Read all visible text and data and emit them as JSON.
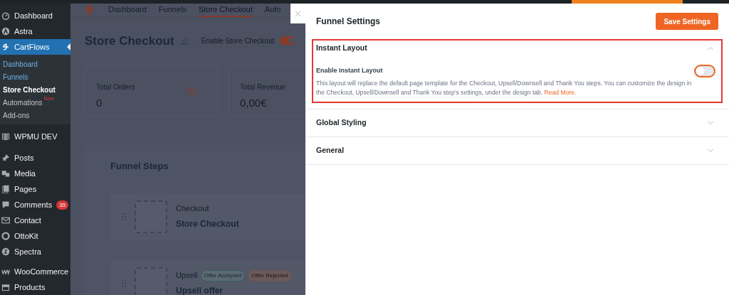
{
  "sidebar": {
    "items": [
      {
        "label": "Dashboard",
        "selected": false
      },
      {
        "label": "Astra",
        "selected": false
      },
      {
        "label": "CartFlows",
        "selected": true,
        "children": [
          {
            "label": "Dashboard",
            "selected": false,
            "link": true
          },
          {
            "label": "Funnels",
            "selected": false,
            "link": true
          },
          {
            "label": "Store Checkout",
            "selected": true,
            "link": false
          },
          {
            "label": "Automations",
            "selected": false,
            "link": false,
            "badge": "New"
          },
          {
            "label": "Add-ons",
            "selected": false,
            "link": false
          }
        ]
      },
      {
        "label": "WPMU DEV",
        "selected": false
      },
      {
        "label": "Posts",
        "selected": false
      },
      {
        "label": "Media",
        "selected": false
      },
      {
        "label": "Pages",
        "selected": false
      },
      {
        "label": "Comments",
        "selected": false,
        "count": "35"
      },
      {
        "label": "Contact",
        "selected": false
      },
      {
        "label": "OttoKit",
        "selected": false
      },
      {
        "label": "Spectra",
        "selected": false
      },
      {
        "label": "WooCommerce",
        "selected": false
      },
      {
        "label": "Products",
        "selected": false
      }
    ]
  },
  "app": {
    "tabs": [
      {
        "label": "Dashboard",
        "selected": false
      },
      {
        "label": "Funnels",
        "selected": false
      },
      {
        "label": "Store Checkout",
        "selected": true
      },
      {
        "label": "Auto",
        "selected": false
      }
    ],
    "title": "Store Checkout",
    "toggle_label": "Enable Store Checkout",
    "toggle_on": true,
    "stats": [
      {
        "label": "Total Orders",
        "value": "0",
        "icon": true
      },
      {
        "label": "Total Revenue",
        "value": "0,00€",
        "icon": false
      }
    ],
    "steps_title": "Funnel Steps",
    "steps": [
      {
        "type": "Checkout",
        "name": "Store Checkout"
      },
      {
        "type": "Upsell",
        "name": "Upsell offer",
        "badges": [
          {
            "label": "Offer Accepted",
            "kind": "accepted"
          },
          {
            "label": "Offer Rejected",
            "kind": "rejected"
          }
        ]
      }
    ]
  },
  "panel": {
    "title": "Funnel Settings",
    "save_button": "Save Settings",
    "sections": [
      {
        "title": "Instant Layout",
        "expanded": true,
        "highlighted": true,
        "setting": {
          "label": "Enable Instant Layout",
          "on": false,
          "description": "This layout will replace the default page template for the Checkout, Upsell/Downsell and Thank You steps. You can customize the design in the Checkout, Upsell/Downsell and Thank You step's settings, under the design tab.",
          "link": "Read More."
        }
      },
      {
        "title": "Global Styling",
        "expanded": false,
        "highlighted": false
      },
      {
        "title": "General",
        "expanded": false,
        "highlighted": false
      }
    ]
  }
}
